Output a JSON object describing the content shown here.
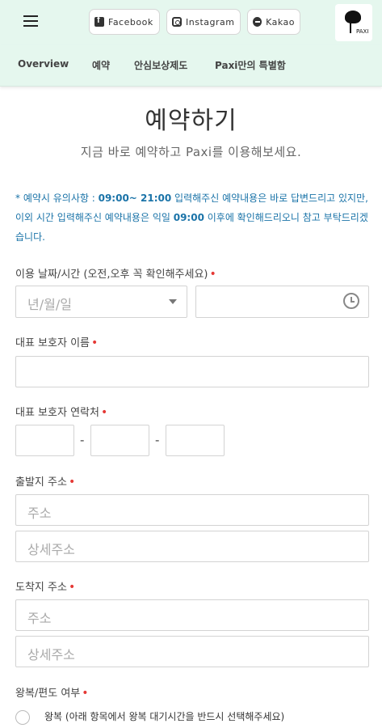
{
  "header": {
    "social": [
      {
        "label": "Facebook",
        "icon": "facebook-icon"
      },
      {
        "label": "Instagram",
        "icon": "instagram-icon"
      },
      {
        "label": "Kakao",
        "icon": "kakao-icon"
      }
    ],
    "logo_text": "PAXI"
  },
  "nav": {
    "items": [
      "Overview",
      "예약",
      "안심보상제도",
      "Paxi만의 특별함"
    ]
  },
  "page": {
    "title": "예약하기",
    "subtitle": "지금 바로 예약하고 Paxi를 이용해보세요.",
    "notice": {
      "prefix": "* 예약시 유의사항 : ",
      "hours": "09:00~ 21:00",
      "text1": " 입력해주신 예약내용은 바로 답변드리고 있지만, 이외 시간 입력해주신 예약내용은 익일 ",
      "next_time": "09:00",
      "text2": " 이후에 확인해드리오니 참고 부탁드리겠습니다."
    }
  },
  "form": {
    "date_label": "이용 날짜/시간 (오전,오후 꼭 확인해주세요)",
    "date_placeholder": "년/월/일",
    "time_value": "",
    "name_label": "대표 보호자 이름",
    "name_value": "",
    "phone_label": "대표 보호자 연락처",
    "phone_sep": "-",
    "phone_parts": [
      "",
      "",
      ""
    ],
    "departure_label": "출발지 주소",
    "departure_address_placeholder": "주소",
    "departure_detail_placeholder": "상세주소",
    "arrival_label": "도착지 주소",
    "arrival_address_placeholder": "주소",
    "arrival_detail_placeholder": "상세주소",
    "trip_label": "왕복/편도 여부",
    "trip_option_round": "왕복 (아래 항목에서 왕복 대기시간을 반드시 선택해주세요)",
    "required_mark": "•"
  },
  "colors": {
    "header_bg": "#e5f7ee",
    "notice_text": "#1a73a8",
    "required": "#e53935"
  }
}
